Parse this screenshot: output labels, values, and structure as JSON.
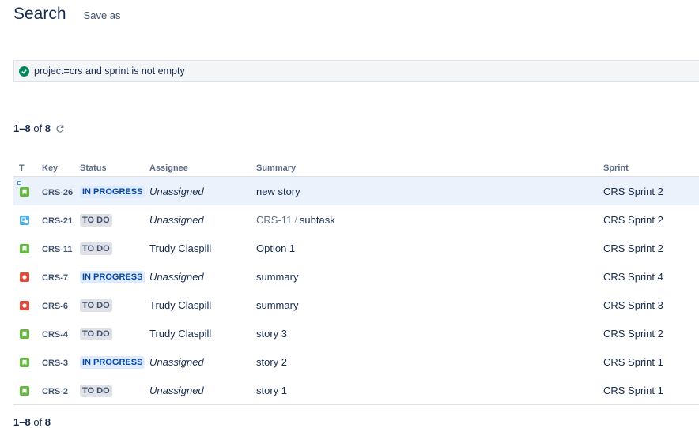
{
  "header": {
    "title": "Search",
    "save_as_label": "Save as"
  },
  "jql": {
    "query": "project=crs and sprint is not empty",
    "status_icon": "check-circle-icon",
    "status_color": "#00875a"
  },
  "results": {
    "range": "1–8",
    "of_label": "of",
    "total": "8"
  },
  "columns": {
    "type": "T",
    "key": "Key",
    "status": "Status",
    "assignee": "Assignee",
    "summary": "Summary",
    "sprint": "Sprint"
  },
  "colors": {
    "story": "#63ba3c",
    "subtask": "#4bade8",
    "bug": "#e5493a",
    "in_progress_bg": "#deebff",
    "todo_bg": "#dfe1e6"
  },
  "rows": [
    {
      "type": "story",
      "key": "CRS-26",
      "status": "IN PROGRESS",
      "assignee": "Unassigned",
      "summary": "new story",
      "sprint": "CRS Sprint 2"
    },
    {
      "type": "subtask",
      "key": "CRS-21",
      "status": "TO DO",
      "assignee": "Unassigned",
      "parent": "CRS-11",
      "separator": "/",
      "summary": "subtask",
      "sprint": "CRS Sprint 2"
    },
    {
      "type": "story",
      "key": "CRS-11",
      "status": "TO DO",
      "assignee": "Trudy Claspill",
      "summary": "Option 1",
      "sprint": "CRS Sprint 2"
    },
    {
      "type": "bug",
      "key": "CRS-7",
      "status": "IN PROGRESS",
      "assignee": "Unassigned",
      "summary": "summary",
      "sprint": "CRS Sprint 4"
    },
    {
      "type": "bug",
      "key": "CRS-6",
      "status": "TO DO",
      "assignee": "Trudy Claspill",
      "summary": "summary",
      "sprint": "CRS Sprint 3"
    },
    {
      "type": "story",
      "key": "CRS-4",
      "status": "TO DO",
      "assignee": "Trudy Claspill",
      "summary": "story 3",
      "sprint": "CRS Sprint 2"
    },
    {
      "type": "story",
      "key": "CRS-3",
      "status": "IN PROGRESS",
      "assignee": "Unassigned",
      "summary": "story 2",
      "sprint": "CRS Sprint 1"
    },
    {
      "type": "story",
      "key": "CRS-2",
      "status": "TO DO",
      "assignee": "Unassigned",
      "summary": "story 1",
      "sprint": "CRS Sprint 1"
    }
  ]
}
